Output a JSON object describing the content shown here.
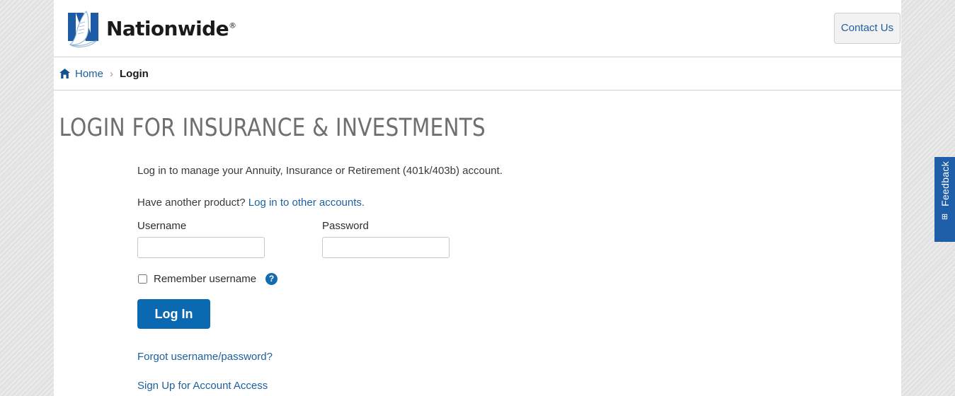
{
  "brand": {
    "name": "Nationwide",
    "registered_mark": "®",
    "logo_icon": "nationwide-eagle-n-logo",
    "logo_blue": "#1d5ca4"
  },
  "header": {
    "contact_button": "Contact Us"
  },
  "breadcrumb": {
    "home_icon": "home-icon",
    "home_label": "Home",
    "separator": "›",
    "current": "Login"
  },
  "main": {
    "title": "LOGIN FOR INSURANCE & INVESTMENTS",
    "intro": "Log in to manage your Annuity, Insurance or Retirement (401k/403b) account.",
    "other_product_prefix": "Have another product? ",
    "other_product_link": "Log in to other accounts.",
    "form": {
      "username_label": "Username",
      "username_value": "",
      "username_placeholder": "",
      "password_label": "Password",
      "password_value": "",
      "password_placeholder": "",
      "remember_label": "Remember username",
      "remember_checked": false,
      "help_icon": "?",
      "submit_label": "Log In"
    },
    "links": [
      "Forgot username/password?",
      "Sign Up for Account Access"
    ]
  },
  "feedback": {
    "label": "Feedback",
    "expand_icon": "⊞",
    "color": "#1f5fa9"
  },
  "colors": {
    "link_blue": "#1c5f9e",
    "button_blue": "#0a69b0",
    "title_gray": "#6d6f71",
    "border_gray": "#d2d2d2"
  }
}
